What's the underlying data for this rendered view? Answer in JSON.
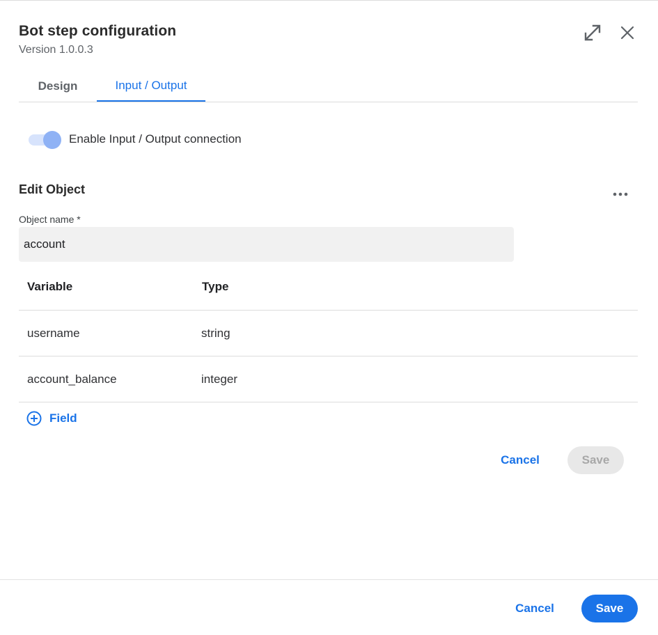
{
  "dialog": {
    "title": "Bot step configuration",
    "version": "Version 1.0.0.3",
    "expand_icon": "expand-diagonal-arrows-icon",
    "close_icon": "close-x-icon"
  },
  "tabs": [
    {
      "label": "Design",
      "active": false
    },
    {
      "label": "Input / Output",
      "active": true
    }
  ],
  "io_toggle": {
    "label": "Enable Input / Output connection",
    "enabled": true
  },
  "edit_object": {
    "title": "Edit Object",
    "more_icon": "more-horizontal-icon",
    "object_name_label": "Object name *",
    "object_name_value": "account",
    "columns": [
      "Variable",
      "Type"
    ],
    "rows": [
      {
        "variable": "username",
        "type": "string"
      },
      {
        "variable": "account_balance",
        "type": "integer"
      }
    ],
    "add_field_label": "Field",
    "add_field_icon": "add-circle-icon",
    "cancel_label": "Cancel",
    "save_label": "Save",
    "save_disabled": true
  },
  "footer": {
    "cancel_label": "Cancel",
    "save_label": "Save"
  },
  "colors": {
    "accent": "#1a73e8",
    "toggle_track": "#d7e3fc",
    "toggle_knob": "#8fb2f5",
    "input_background": "#f1f1f1",
    "disabled_button": "#e8e8e8"
  }
}
